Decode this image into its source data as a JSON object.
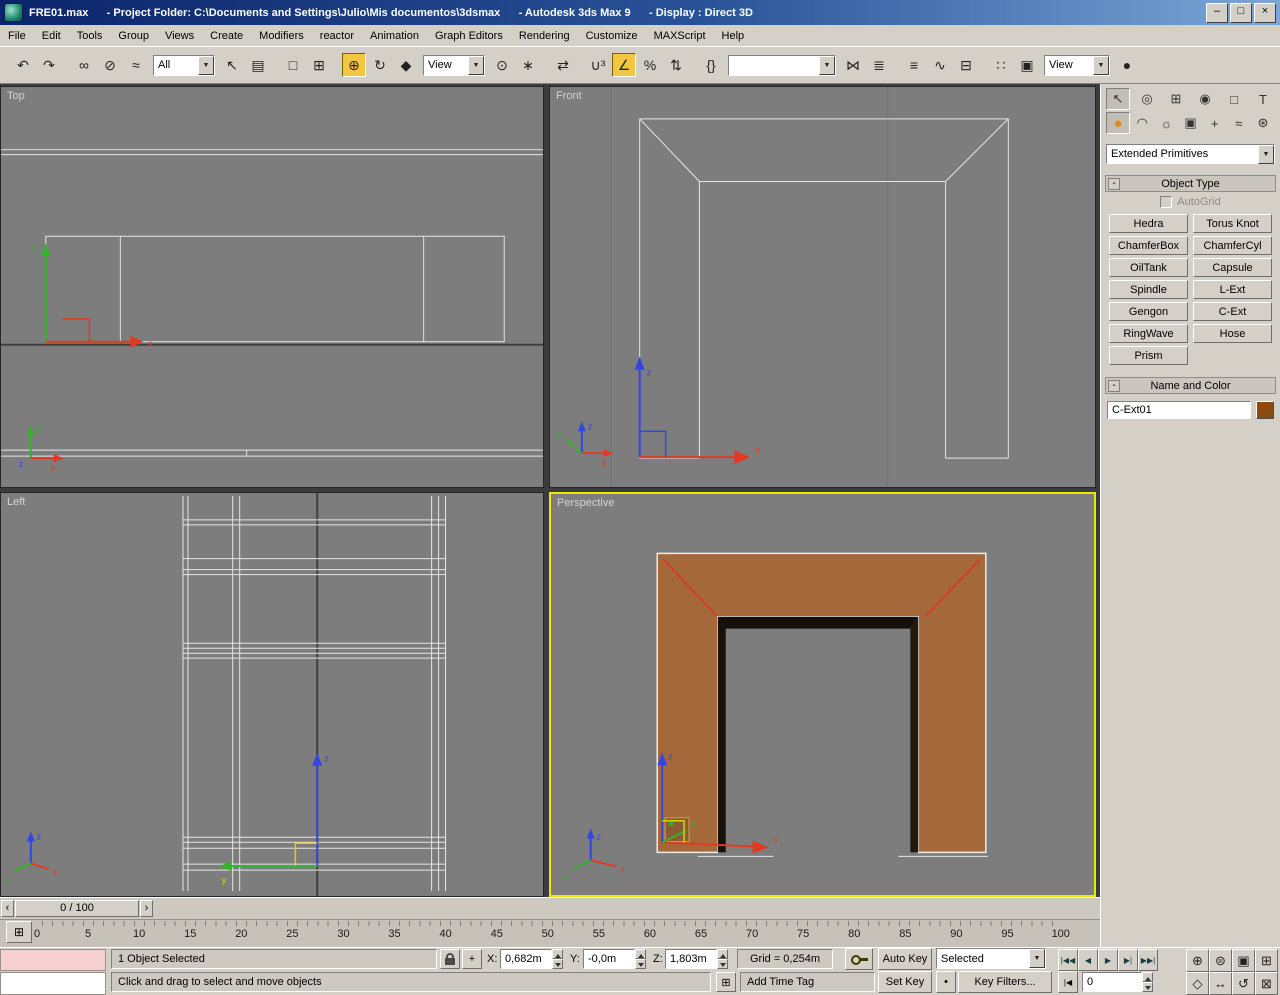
{
  "colors": {
    "accent": "#f2c641",
    "object-color": "#8a4a10",
    "object-brown": "#a5683a",
    "viewport-bg": "#7d7d7d",
    "active-border": "#e8e800"
  },
  "window": {
    "title": "FRE01.max      - Project Folder: C:\\Documents and Settings\\Julio\\Mis documentos\\3dsmax      - Autodesk 3ds Max 9      - Display : Direct 3D",
    "buttons": [
      {
        "name": "minimize-button",
        "glyph": "–"
      },
      {
        "name": "maximize-button",
        "glyph": "□"
      },
      {
        "name": "close-button",
        "glyph": "×"
      }
    ]
  },
  "icons": {
    "chevron_down": "▼"
  },
  "menu": {
    "items": [
      "File",
      "Edit",
      "Tools",
      "Group",
      "Views",
      "Create",
      "Modifiers",
      "reactor",
      "Animation",
      "Graph Editors",
      "Rendering",
      "Customize",
      "MAXScript",
      "Help"
    ]
  },
  "toolbar": {
    "filter_value": "All",
    "refcoord_value": "View",
    "named_sets_value": "",
    "render_value": "View",
    "group1": [
      {
        "name": "undo-button",
        "glyph": "↶"
      },
      {
        "name": "redo-button",
        "glyph": "↷"
      }
    ],
    "group2": [
      {
        "name": "select-and-link-button",
        "glyph": "∞"
      },
      {
        "name": "unlink-selection-button",
        "glyph": "⊘"
      },
      {
        "name": "bind-to-space-warp-button",
        "glyph": "≈"
      }
    ],
    "group3": [
      {
        "name": "select-object-button",
        "glyph": "↖"
      },
      {
        "name": "select-by-name-button",
        "glyph": "▤"
      }
    ],
    "group4": [
      {
        "name": "rectangular-selection-region-button",
        "glyph": "□"
      },
      {
        "name": "window-crossing-toggle",
        "glyph": "⊞"
      }
    ],
    "group5": [
      {
        "name": "select-and-move-button",
        "glyph": "⊕",
        "state": "active"
      },
      {
        "name": "select-and-rotate-button",
        "glyph": "↻"
      },
      {
        "name": "select-and-scale-button",
        "glyph": "◆"
      }
    ],
    "group6": [
      {
        "name": "use-pivot-center-button",
        "glyph": "⊙"
      },
      {
        "name": "select-and-manipulate-button",
        "glyph": "∗"
      }
    ],
    "group7": [
      {
        "name": "keyboard-shortcut-override-toggle",
        "glyph": "⇄"
      }
    ],
    "group8": [
      {
        "name": "snaps-toggle-3d",
        "glyph": "∪³"
      },
      {
        "name": "angle-snap-toggle",
        "glyph": "∠",
        "state": "active"
      },
      {
        "name": "percent-snap-toggle",
        "glyph": "%"
      },
      {
        "name": "spinner-snap-toggle",
        "glyph": "⇅"
      }
    ],
    "group9": [
      {
        "name": "named-selection-sets-button",
        "glyph": "{}"
      }
    ],
    "group10": [
      {
        "name": "mirror-button",
        "glyph": "⋈"
      },
      {
        "name": "align-button",
        "glyph": "≣"
      }
    ],
    "group11": [
      {
        "name": "layer-manager-button",
        "glyph": "≡"
      },
      {
        "name": "curve-editor-button",
        "glyph": "∿"
      },
      {
        "name": "schematic-view-button",
        "glyph": "⊟"
      }
    ],
    "group12": [
      {
        "name": "material-editor-button",
        "glyph": "∷"
      },
      {
        "name": "render-setup-button",
        "glyph": "▣"
      }
    ],
    "group13": [
      {
        "name": "quick-render-button",
        "glyph": "●"
      }
    ]
  },
  "viewports": {
    "top": {
      "label": "Top"
    },
    "front": {
      "label": "Front"
    },
    "left": {
      "label": "Left"
    },
    "perspective": {
      "label": "Perspective"
    },
    "axis": {
      "x": "x",
      "y": "y",
      "z": "z"
    }
  },
  "command_panel": {
    "tabs": [
      {
        "name": "tab-create",
        "glyph": "↖",
        "state": "active"
      },
      {
        "name": "tab-modify",
        "glyph": "◎"
      },
      {
        "name": "tab-hierarchy",
        "glyph": "⊞"
      },
      {
        "name": "tab-motion",
        "glyph": "◉"
      },
      {
        "name": "tab-display",
        "glyph": "□"
      },
      {
        "name": "tab-utilities",
        "glyph": "T"
      }
    ],
    "categories": [
      {
        "name": "category-geometry",
        "glyph": "●",
        "state": "active"
      },
      {
        "name": "category-shapes",
        "glyph": "◠"
      },
      {
        "name": "category-lights",
        "glyph": "☼"
      },
      {
        "name": "category-cameras",
        "glyph": "▣"
      },
      {
        "name": "category-helpers",
        "glyph": "+"
      },
      {
        "name": "category-space-warps",
        "glyph": "≈"
      },
      {
        "name": "category-systems",
        "glyph": "⊛"
      }
    ],
    "dropdown_value": "Extended Primitives",
    "rollout_object_type": "Object Type",
    "minus": "-",
    "autogrid_label": "AutoGrid",
    "object_buttons": [
      "Hedra",
      "Torus Knot",
      "ChamferBox",
      "ChamferCyl",
      "OilTank",
      "Capsule",
      "Spindle",
      "L-Ext",
      "Gengon",
      "C-Ext",
      "RingWave",
      "Hose",
      "Prism"
    ],
    "rollout_name_color": "Name and Color",
    "object_name": "C-Ext01"
  },
  "timeline": {
    "slider_value": "0 / 100",
    "left_arrow": "‹",
    "right_arrow": "›",
    "mini_curve_editor_glyph": "⊞",
    "ticks": [
      "0",
      "5",
      "10",
      "15",
      "20",
      "25",
      "30",
      "35",
      "40",
      "45",
      "50",
      "55",
      "60",
      "65",
      "70",
      "75",
      "80",
      "85",
      "90",
      "95",
      "100"
    ]
  },
  "status": {
    "selection": "1 Object Selected",
    "prompt": "Click and drag to select and move objects",
    "x_label": "X:",
    "y_label": "Y:",
    "z_label": "Z:",
    "x_value": "0,682m",
    "y_value": "-0,0m",
    "z_value": "1,803m",
    "grid_value": "Grid = 0,254m",
    "add_time_tag": "Add Time Tag",
    "auto_key": "Auto Key",
    "set_key": "Set Key",
    "key_filters": "Key Filters...",
    "selected_dropdown": "Selected",
    "frame_value": "0",
    "status_toggle_glyph": "⊞",
    "set_key_filter_glyph": "•",
    "key_mode_glyph": "|◀",
    "playback": [
      {
        "name": "go-to-start-button",
        "glyph": "|◀◀"
      },
      {
        "name": "previous-frame-button",
        "glyph": "◀"
      },
      {
        "name": "play-button",
        "glyph": "▶"
      },
      {
        "name": "next-frame-button",
        "glyph": "▶|"
      },
      {
        "name": "go-to-end-button",
        "glyph": "▶▶|"
      }
    ],
    "nav_row1": [
      {
        "name": "zoom-button",
        "glyph": "⊕"
      },
      {
        "name": "zoom-all-button",
        "glyph": "⊜"
      },
      {
        "name": "zoom-extents-button",
        "glyph": "▣"
      },
      {
        "name": "zoom-extents-all-button",
        "glyph": "⊞"
      }
    ],
    "nav_row2": [
      {
        "name": "field-of-view-button",
        "glyph": "◇"
      },
      {
        "name": "pan-button",
        "glyph": "↔"
      },
      {
        "name": "arc-rotate-button",
        "glyph": "↺"
      },
      {
        "name": "maximize-viewport-toggle",
        "glyph": "⊠"
      }
    ]
  }
}
